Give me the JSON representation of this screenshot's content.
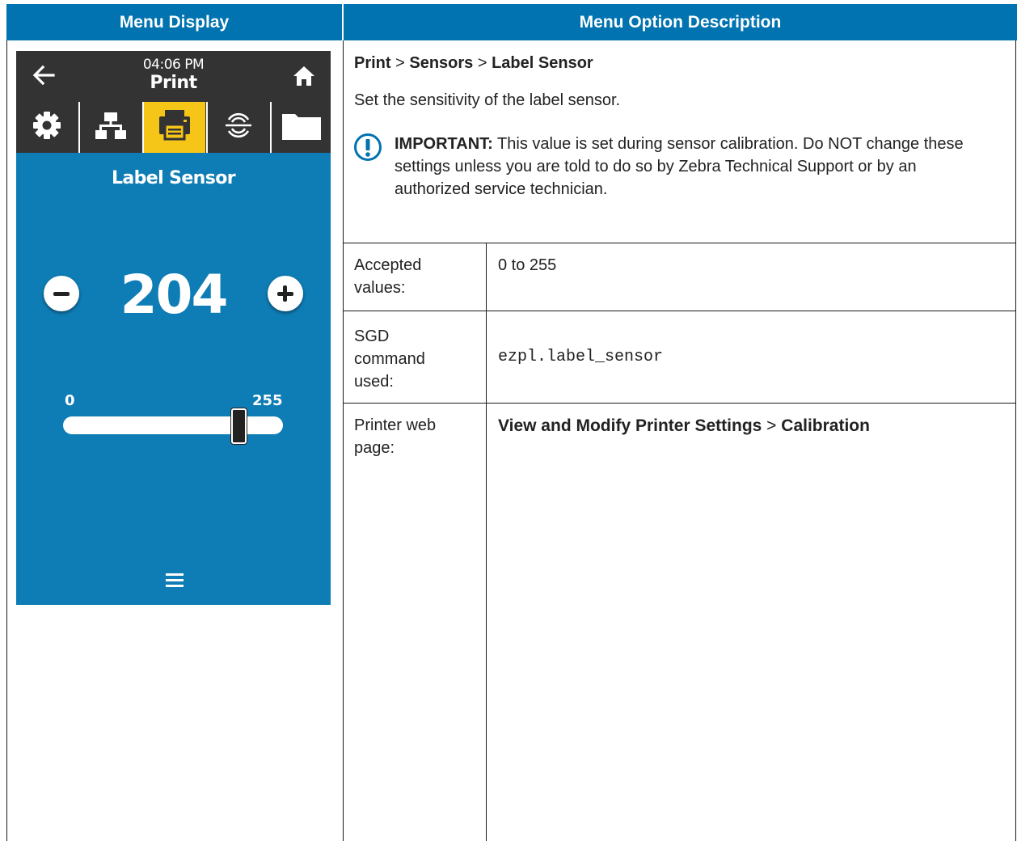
{
  "table": {
    "header_left": "Menu Display",
    "header_right": "Menu Option Description"
  },
  "device": {
    "time": "04:06 PM",
    "title": "Print",
    "setting_title": "Label Sensor",
    "value": "204",
    "range_min": "0",
    "range_max": "255",
    "slider_fraction": 0.8,
    "active_tab": "print",
    "tabs": [
      "gear-icon",
      "network-icon",
      "printer-icon",
      "sensor-icon",
      "folder-icon"
    ],
    "colors": {
      "screen_blue": "#0f7db5",
      "bar_gray": "#333333",
      "active_yellow": "#f5c518",
      "header_blue": "#0073b0"
    }
  },
  "description": {
    "path": {
      "part1": "Print",
      "sep1": " > ",
      "part2": "Sensors",
      "sep2": " > ",
      "part3": "Label Sensor"
    },
    "summary": "Set the sensitivity of the label sensor.",
    "important_label": "IMPORTANT:",
    "important_text": " This value is set during sensor calibration. Do NOT change these settings unless you are told to do so by Zebra Technical Support or by an authorized service technician.",
    "rows": [
      {
        "label": "Accepted values:",
        "value": "0 to 255"
      },
      {
        "label": "SGD command used:",
        "value": "ezpl.label_sensor"
      },
      {
        "label": "Printer web page:",
        "value_part1": "View and Modify Printer Settings",
        "value_sep": " > ",
        "value_part2": "Calibration"
      }
    ]
  }
}
